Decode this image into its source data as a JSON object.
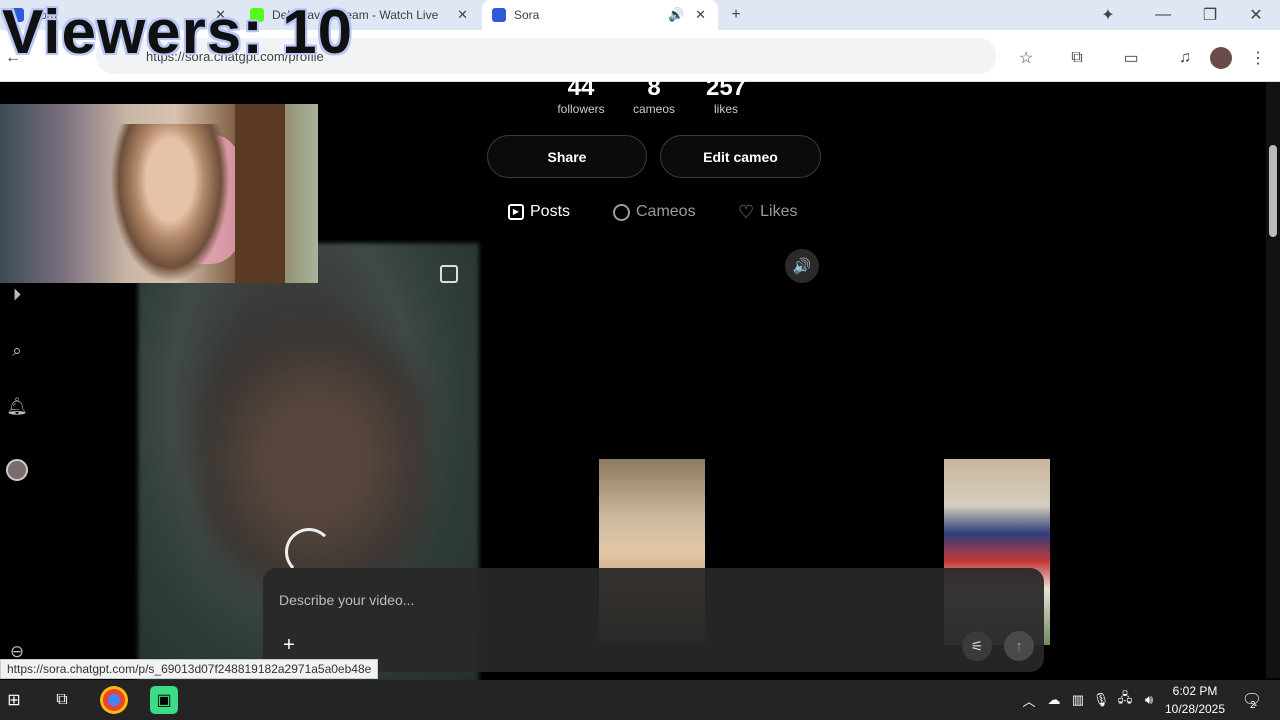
{
  "browser": {
    "tabs": [
      {
        "title": "Sora",
        "active": false
      },
      {
        "title": "Dellywave Stream - Watch Live",
        "active": false
      },
      {
        "title": "Sora",
        "active": true
      }
    ],
    "url": "https://sora.chatgpt.com/profile",
    "status_url": "https://sora.chatgpt.com/p/s_69013d07f248819182a2971a5a0eb48e"
  },
  "overlay": {
    "viewers": "Viewers: 10"
  },
  "profile": {
    "stats": [
      {
        "value": "44",
        "label": "followers"
      },
      {
        "value": "8",
        "label": "cameos"
      },
      {
        "value": "257",
        "label": "likes"
      }
    ],
    "share_label": "Share",
    "edit_cameo_label": "Edit cameo",
    "tabs": [
      {
        "label": "Posts",
        "icon": "posts-icon",
        "active": true
      },
      {
        "label": "Cameos",
        "icon": "cameos-icon",
        "active": false
      },
      {
        "label": "Likes",
        "icon": "heart-icon",
        "active": false
      }
    ]
  },
  "composer": {
    "placeholder": "Describe your video..."
  },
  "taskbar": {
    "time": "6:02 PM",
    "date": "10/28/2025",
    "notification_count": "2"
  },
  "colors": {
    "page_bg": "#000000",
    "taskbar_bg": "#242424",
    "tabstrip_bg": "#dfe7f5"
  }
}
